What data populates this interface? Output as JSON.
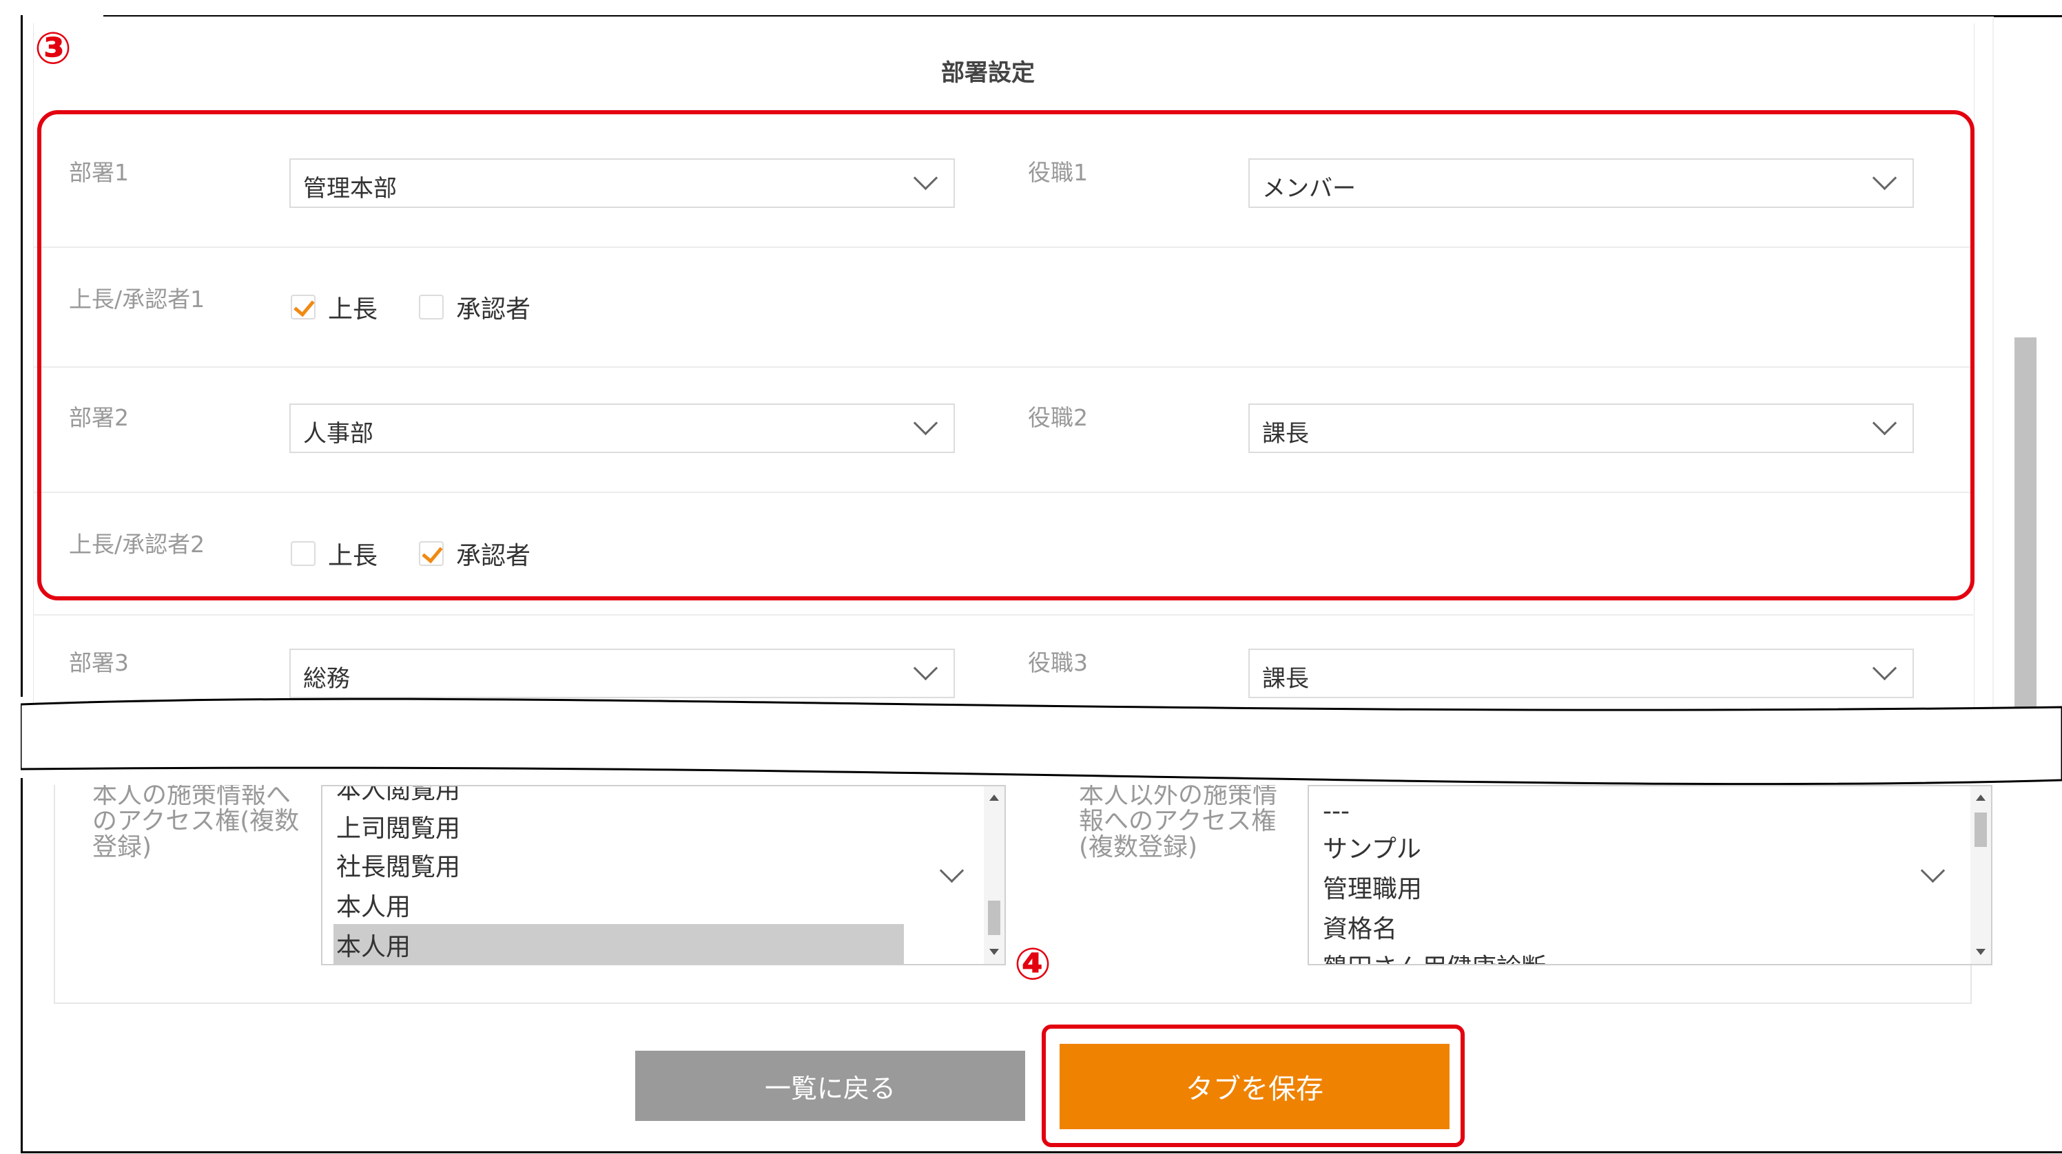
{
  "colors": {
    "annotation_red": "#e3000f",
    "accent_orange": "#ef8200",
    "back_button_gray": "#9a9a9a",
    "label_gray": "#999999"
  },
  "annotations": {
    "marker_3": "③",
    "marker_4": "④"
  },
  "section": {
    "title": "部署設定"
  },
  "rows": {
    "dept1": {
      "label": "部署1",
      "value": "管理本部"
    },
    "pos1": {
      "label": "役職1",
      "value": "メンバー"
    },
    "approver1": {
      "label": "上長/承認者1",
      "boss_label": "上長",
      "boss_checked": true,
      "approver_label": "承認者",
      "approver_checked": false
    },
    "dept2": {
      "label": "部署2",
      "value": "人事部"
    },
    "pos2": {
      "label": "役職2",
      "value": "課長"
    },
    "approver2": {
      "label": "上長/承認者2",
      "boss_label": "上長",
      "boss_checked": false,
      "approver_label": "承認者",
      "approver_checked": true
    },
    "dept3": {
      "label": "部署3",
      "value": "総務"
    },
    "pos3": {
      "label": "役職3",
      "value": "課長"
    }
  },
  "access": {
    "self": {
      "label_lines": [
        "本人の施策情報へ",
        "のアクセス権(複数",
        "登録)"
      ],
      "items": [
        "本人閲覧用",
        "上司閲覧用",
        "社長閲覧用",
        "本人用",
        "本人用"
      ],
      "selected_index": 4
    },
    "others": {
      "label_lines": [
        "本人以外の施策情",
        "報へのアクセス権",
        "(複数登録)"
      ],
      "items": [
        "---",
        "サンプル",
        "管理職用",
        "資格名",
        "鶴田さん用健康診断"
      ]
    }
  },
  "buttons": {
    "back": "一覧に戻る",
    "save": "タブを保存"
  },
  "icons": [
    "chevron-down-icon",
    "checkmark-icon",
    "scroll-up-arrow-icon",
    "scroll-down-arrow-icon"
  ]
}
